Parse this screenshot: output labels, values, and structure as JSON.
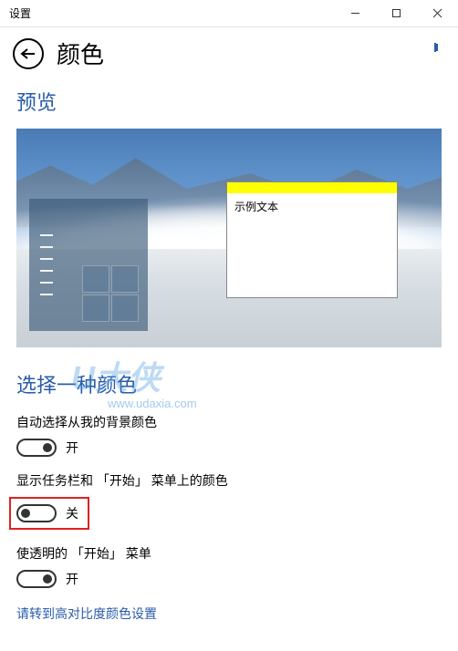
{
  "window": {
    "title": "设置"
  },
  "header": {
    "page_title": "颜色"
  },
  "preview": {
    "section_title": "预览",
    "sample_text": "示例文本"
  },
  "choose": {
    "section_title": "选择一种颜色"
  },
  "watermark": {
    "text": "U大侠",
    "url": "www.udaxia.com"
  },
  "options": {
    "auto_pick": {
      "label": "自动选择从我的背景颜色",
      "state": "开",
      "on": true
    },
    "show_taskbar": {
      "label": "显示任务栏和 「开始」 菜单上的颜色",
      "state": "关",
      "on": false
    },
    "transparent_start": {
      "label": "使透明的 「开始」 菜单",
      "state": "开",
      "on": true
    }
  },
  "link": {
    "high_contrast": "请转到高对比度颜色设置"
  }
}
